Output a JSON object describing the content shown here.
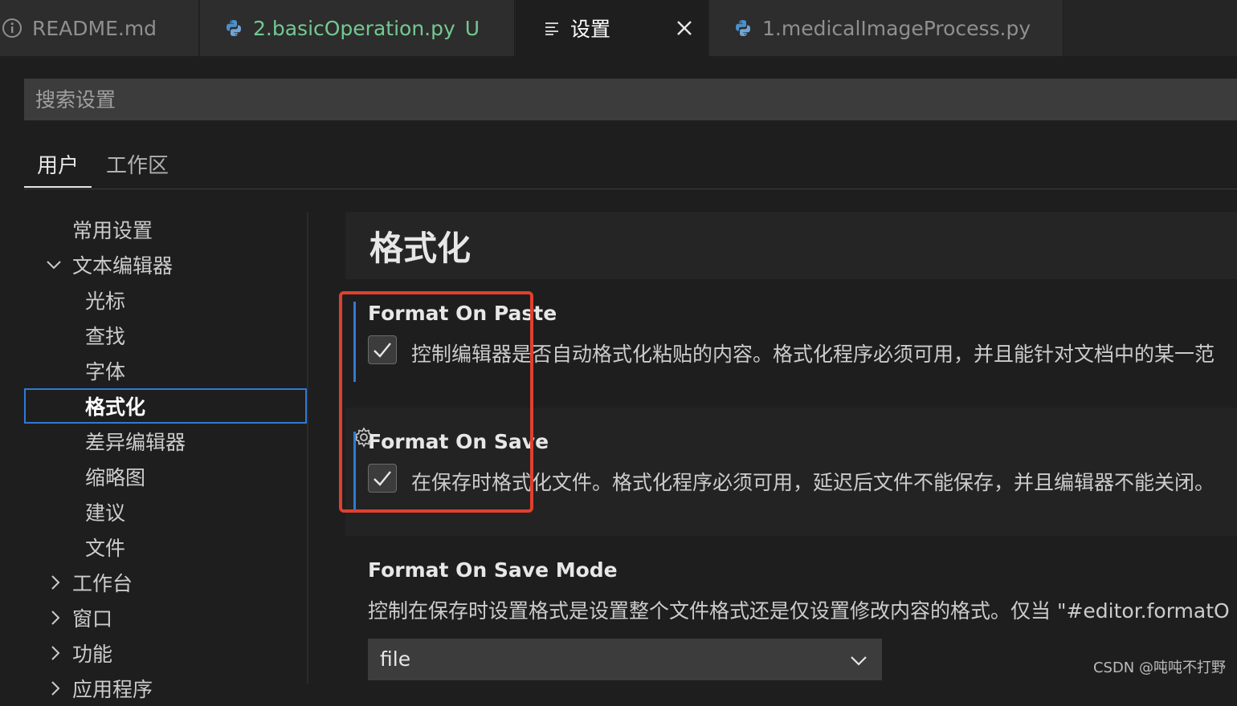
{
  "tabs": [
    {
      "label": "README.md",
      "icon": "info-icon",
      "status": ""
    },
    {
      "label": "2.basicOperation.py",
      "icon": "python-icon",
      "status": "U"
    },
    {
      "label": "设置",
      "icon": "list-icon",
      "status": ""
    },
    {
      "label": "1.medicalImageProcess.py",
      "icon": "python-icon",
      "status": ""
    }
  ],
  "search": {
    "placeholder": "搜索设置"
  },
  "scope_tabs": [
    "用户",
    "工作区"
  ],
  "toc": [
    {
      "label": "常用设置"
    },
    {
      "label": "文本编辑器"
    },
    {
      "label": "光标"
    },
    {
      "label": "查找"
    },
    {
      "label": "字体"
    },
    {
      "label": "格式化"
    },
    {
      "label": "差异编辑器"
    },
    {
      "label": "缩略图"
    },
    {
      "label": "建议"
    },
    {
      "label": "文件"
    },
    {
      "label": "工作台"
    },
    {
      "label": "窗口"
    },
    {
      "label": "功能"
    },
    {
      "label": "应用程序"
    }
  ],
  "section": {
    "title": "格式化"
  },
  "settings": {
    "paste": {
      "title": "Format On Paste",
      "checked": true,
      "description": "控制编辑器是否自动格式化粘贴的内容。格式化程序必须可用，并且能针对文档中的某一范"
    },
    "save": {
      "title": "Format On Save",
      "checked": true,
      "description": "在保存时格式化文件。格式化程序必须可用，延迟后文件不能保存，并且编辑器不能关闭。"
    },
    "save_mode": {
      "title": "Format On Save Mode",
      "description": "控制在保存时设置格式是设置整个文件格式还是仅设置修改内容的格式。仅当 \"#editor.formatO",
      "value": "file"
    }
  },
  "watermark": "CSDN @吨吨不打野",
  "colors": {
    "accent": "#2f7ad6",
    "highlight": "#e0402f",
    "untracked": "#73c991"
  }
}
